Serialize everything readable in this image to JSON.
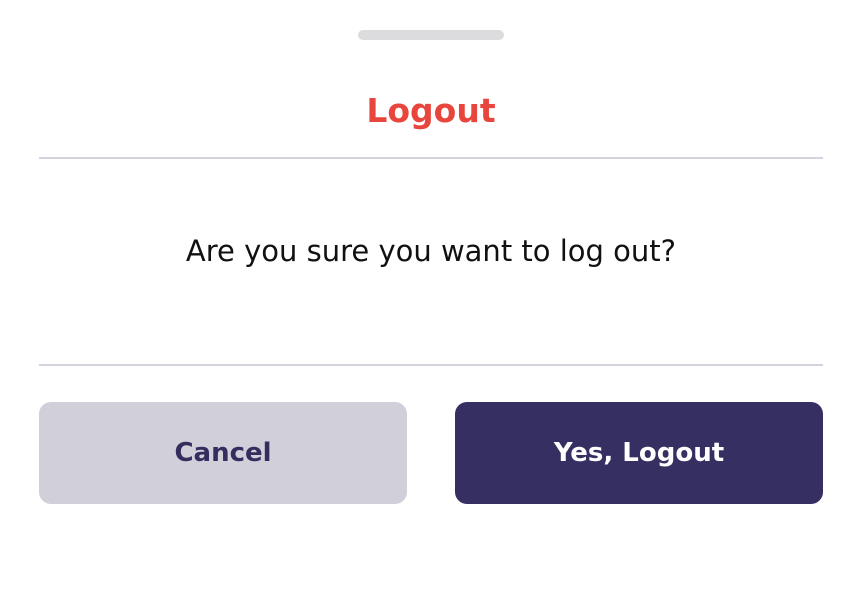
{
  "dialog": {
    "title": "Logout",
    "message": "Are you sure you want to log out?",
    "cancel_label": "Cancel",
    "confirm_label": "Yes, Logout"
  },
  "colors": {
    "title": "#e8453c",
    "cancel_bg": "#d0cfda",
    "cancel_text": "#352d5e",
    "confirm_bg": "#362f61",
    "confirm_text": "#ffffff",
    "divider": "#d4d2dc",
    "handle": "#dcdcdf"
  }
}
